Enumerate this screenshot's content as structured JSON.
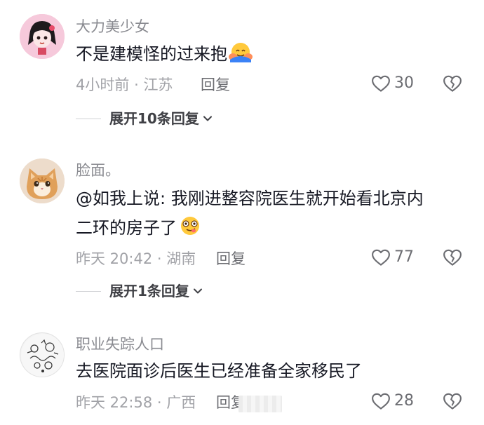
{
  "comments": [
    {
      "username": "大力美少女",
      "text": "不是建模怪的过来抱",
      "time": "4小时前",
      "location": "江苏",
      "reply_label": "回复",
      "likes": "30",
      "expand_label": "展开10条回复",
      "avatar_icon": "anime-girl-avatar",
      "emoji_icon": "hugging-face-emoji"
    },
    {
      "username": "脸面。",
      "text_line1": "@如我上说: 我刚进整容院医生就开始看北京内",
      "text_line2": "二环的房子了",
      "time": "昨天 20:42",
      "location": "湖南",
      "reply_label": "回复",
      "likes": "77",
      "expand_label": "展开1条回复",
      "avatar_icon": "orange-cat-avatar",
      "emoji_icon": "woozy-face-emoji"
    },
    {
      "username": "职业失踪人口",
      "text": "去医院面诊后医生已经准备全家移民了",
      "time": "昨天 22:58",
      "location": "广西",
      "reply_label": "回复",
      "likes": "28",
      "avatar_icon": "doodle-avatar"
    }
  ],
  "separator": "·"
}
